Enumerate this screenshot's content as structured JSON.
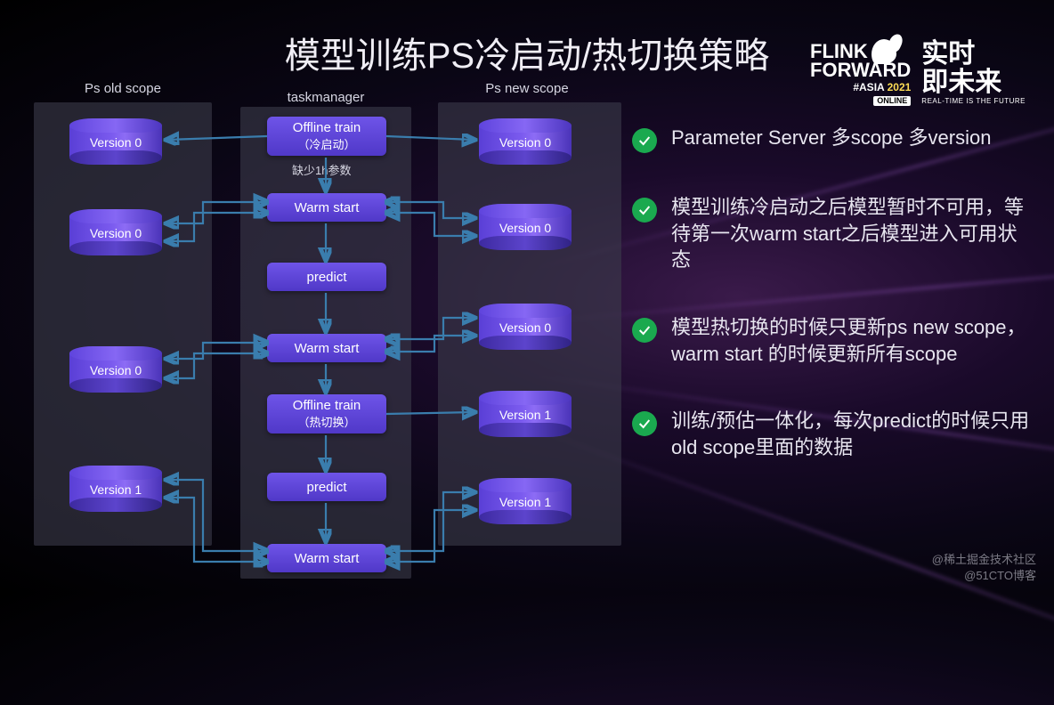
{
  "title": "模型训练PS冷启动/热切换策略",
  "logo": {
    "flink": "FLINK",
    "forward": "FORWARD",
    "asia": "#ASIA",
    "year": "2021",
    "online": "ONLINE",
    "cn_line1": "实时",
    "cn_line2": "即未来",
    "cn_sub": "REAL-TIME IS THE FUTURE"
  },
  "bullets": [
    "Parameter Server 多scope 多version",
    "模型训练冷启动之后模型暂时不可用，等待第一次warm start之后模型进入可用状态",
    "模型热切换的时候只更新ps new scope，warm start 的时候更新所有scope",
    "训练/预估一体化，每次predict的时候只用old scope里面的数据"
  ],
  "columns": {
    "old": "Ps old scope",
    "task": "taskmanager",
    "new": "Ps new scope"
  },
  "note_missing": "缺少1h参数",
  "old_versions": [
    "Version 0",
    "Version 0",
    "Version 0",
    "Version 1"
  ],
  "new_versions": [
    "Version 0",
    "Version 0",
    "Version 0",
    "Version 1",
    "Version 1"
  ],
  "task_nodes": {
    "offline_cold": "Offline train",
    "offline_cold_sub": "（冷启动）",
    "warm1": "Warm start",
    "predict1": "predict",
    "warm2": "Warm start",
    "offline_hot": "Offline train",
    "offline_hot_sub": "（热切换）",
    "predict2": "predict",
    "warm3": "Warm start"
  },
  "watermark": {
    "l1": "@稀土掘金技术社区",
    "l2": "@51CTO博客"
  },
  "chart_data": {
    "type": "diagram",
    "title": "模型训练PS冷启动/热切换策略",
    "columns": [
      {
        "id": "ps_old",
        "label": "Ps old scope",
        "items": [
          "Version 0",
          "Version 0",
          "Version 0",
          "Version 1"
        ]
      },
      {
        "id": "taskmanager",
        "label": "taskmanager",
        "items": [
          "Offline train（冷启动）",
          "Warm start",
          "predict",
          "Warm start",
          "Offline train（热切换）",
          "predict",
          "Warm start"
        ]
      },
      {
        "id": "ps_new",
        "label": "Ps new scope",
        "items": [
          "Version 0",
          "Version 0",
          "Version 0",
          "Version 1",
          "Version 1"
        ]
      }
    ],
    "annotations": [
      {
        "after": "Offline train（冷启动）",
        "text": "缺少1h参数"
      }
    ],
    "edges": [
      {
        "from": "taskmanager.Offline train（冷启动）",
        "to": "ps_old.Version 0[0]",
        "dir": "uni"
      },
      {
        "from": "taskmanager.Offline train（冷启动）",
        "to": "ps_new.Version 0[0]",
        "dir": "uni"
      },
      {
        "from": "taskmanager.Offline train（冷启动）",
        "to": "taskmanager.Warm start[0]",
        "dir": "uni"
      },
      {
        "from": "taskmanager.Warm start[0]",
        "to": "ps_old.Version 0[1]",
        "dir": "bi"
      },
      {
        "from": "taskmanager.Warm start[0]",
        "to": "ps_new.Version 0[1]",
        "dir": "bi"
      },
      {
        "from": "taskmanager.Warm start[0]",
        "to": "taskmanager.predict[0]",
        "dir": "uni"
      },
      {
        "from": "taskmanager.predict[0]",
        "to": "taskmanager.Warm start[1]",
        "dir": "uni"
      },
      {
        "from": "taskmanager.Warm start[1]",
        "to": "ps_old.Version 0[2]",
        "dir": "bi"
      },
      {
        "from": "taskmanager.Warm start[1]",
        "to": "ps_new.Version 0[2]",
        "dir": "bi"
      },
      {
        "from": "taskmanager.Warm start[1]",
        "to": "taskmanager.Offline train（热切换）",
        "dir": "uni"
      },
      {
        "from": "taskmanager.Offline train（热切换）",
        "to": "ps_new.Version 1[0]",
        "dir": "uni"
      },
      {
        "from": "taskmanager.Offline train（热切换）",
        "to": "taskmanager.predict[1]",
        "dir": "uni"
      },
      {
        "from": "taskmanager.predict[1]",
        "to": "taskmanager.Warm start[2]",
        "dir": "uni"
      },
      {
        "from": "taskmanager.Warm start[2]",
        "to": "ps_old.Version 1",
        "dir": "bi"
      },
      {
        "from": "taskmanager.Warm start[2]",
        "to": "ps_new.Version 1[1]",
        "dir": "bi"
      }
    ]
  }
}
